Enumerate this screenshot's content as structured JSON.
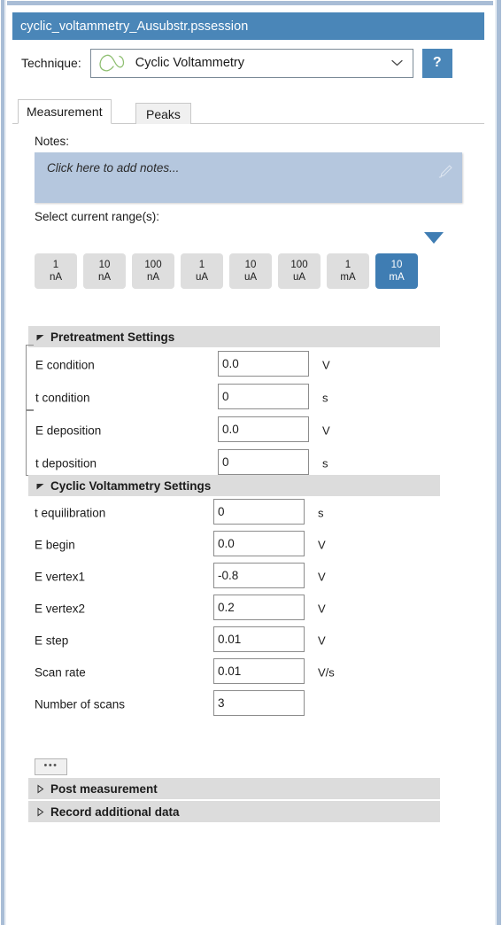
{
  "window": {
    "title": "cyclic_voltammetry_Ausubstr.pssession"
  },
  "technique": {
    "label": "Technique:",
    "selected": "Cyclic Voltammetry",
    "icon": "cyclic-voltammogram-icon",
    "chevron_icon": "chevron-down-icon",
    "help_label": "?"
  },
  "tabs": [
    {
      "label": "Measurement",
      "active": true
    },
    {
      "label": "Peaks",
      "active": false
    }
  ],
  "notes": {
    "label": "Notes:",
    "placeholder": "Click here to add notes...",
    "value": "",
    "edit_icon": "pencil-icon"
  },
  "current_range": {
    "label": "Select current range(s):",
    "selected_index": 7,
    "options": [
      {
        "value": "1",
        "unit": "nA"
      },
      {
        "value": "10",
        "unit": "nA"
      },
      {
        "value": "100",
        "unit": "nA"
      },
      {
        "value": "1",
        "unit": "uA"
      },
      {
        "value": "10",
        "unit": "uA"
      },
      {
        "value": "100",
        "unit": "uA"
      },
      {
        "value": "1",
        "unit": "mA"
      },
      {
        "value": "10",
        "unit": "mA"
      }
    ]
  },
  "sections": [
    {
      "title": "Pretreatment Settings",
      "expanded": true,
      "fields": [
        {
          "label": "E condition",
          "value": "0.0",
          "unit": "V"
        },
        {
          "label": "t condition",
          "value": "0",
          "unit": "s"
        },
        {
          "label": "E deposition",
          "value": "0.0",
          "unit": "V"
        },
        {
          "label": "t deposition",
          "value": "0",
          "unit": "s"
        }
      ]
    },
    {
      "title": "Cyclic Voltammetry Settings",
      "expanded": true,
      "fields": [
        {
          "label": "t equilibration",
          "value": "0",
          "unit": "s"
        },
        {
          "label": "E begin",
          "value": "0.0",
          "unit": "V"
        },
        {
          "label": "E vertex1",
          "value": "-0.8",
          "unit": "V"
        },
        {
          "label": "E vertex2",
          "value": "0.2",
          "unit": "V"
        },
        {
          "label": "E step",
          "value": "0.01",
          "unit": "V"
        },
        {
          "label": "Scan rate",
          "value": "0.01",
          "unit": "V/s"
        },
        {
          "label": "Number of scans",
          "value": "3",
          "unit": ""
        }
      ]
    },
    {
      "title": "Post measurement",
      "expanded": false,
      "fields": []
    },
    {
      "title": "Record additional data",
      "expanded": false,
      "fields": []
    }
  ],
  "more_button": {
    "label": "•••"
  },
  "colors": {
    "accent_blue": "#4a86b8",
    "selected_range_blue": "#3f7db3",
    "notes_blue": "#b5c7de",
    "section_gray": "#dcdcdc",
    "range_gray": "#dedede",
    "window_border": "#a9bdd6"
  }
}
